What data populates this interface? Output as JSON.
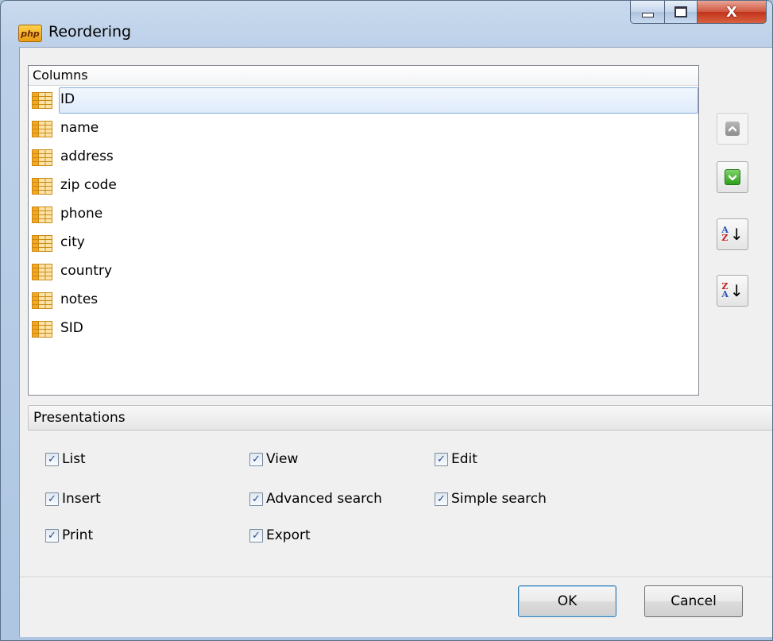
{
  "window": {
    "title": "Reordering",
    "app_icon_text": "php",
    "close_glyph": "X"
  },
  "columns": {
    "header": "Columns",
    "items": [
      "ID",
      "name",
      "address",
      "zip code",
      "phone",
      "city",
      "country",
      "notes",
      "SID"
    ],
    "selected": "ID"
  },
  "side_buttons": {
    "up_icon": "move-up-icon",
    "down_icon": "move-down-icon",
    "sort_az_icon": "sort-ascending-icon",
    "sort_za_icon": "sort-descending-icon"
  },
  "presentations": {
    "header": "Presentations",
    "options": [
      {
        "label": "List",
        "checked": true
      },
      {
        "label": "View",
        "checked": true
      },
      {
        "label": "Edit",
        "checked": true
      },
      {
        "label": "Insert",
        "checked": true
      },
      {
        "label": "Advanced search",
        "checked": true
      },
      {
        "label": "Simple search",
        "checked": true
      },
      {
        "label": "Print",
        "checked": true
      },
      {
        "label": "Export",
        "checked": true
      }
    ]
  },
  "buttons": {
    "ok": "OK",
    "cancel": "Cancel"
  },
  "glyphs": {
    "check": "✓",
    "sort_a": "A",
    "sort_z": "Z",
    "sort_arrow": "↓"
  },
  "colors": {
    "selection_border": "#84acdd",
    "table_icon": "#f5a623",
    "green_button": "#2f9e1d"
  }
}
